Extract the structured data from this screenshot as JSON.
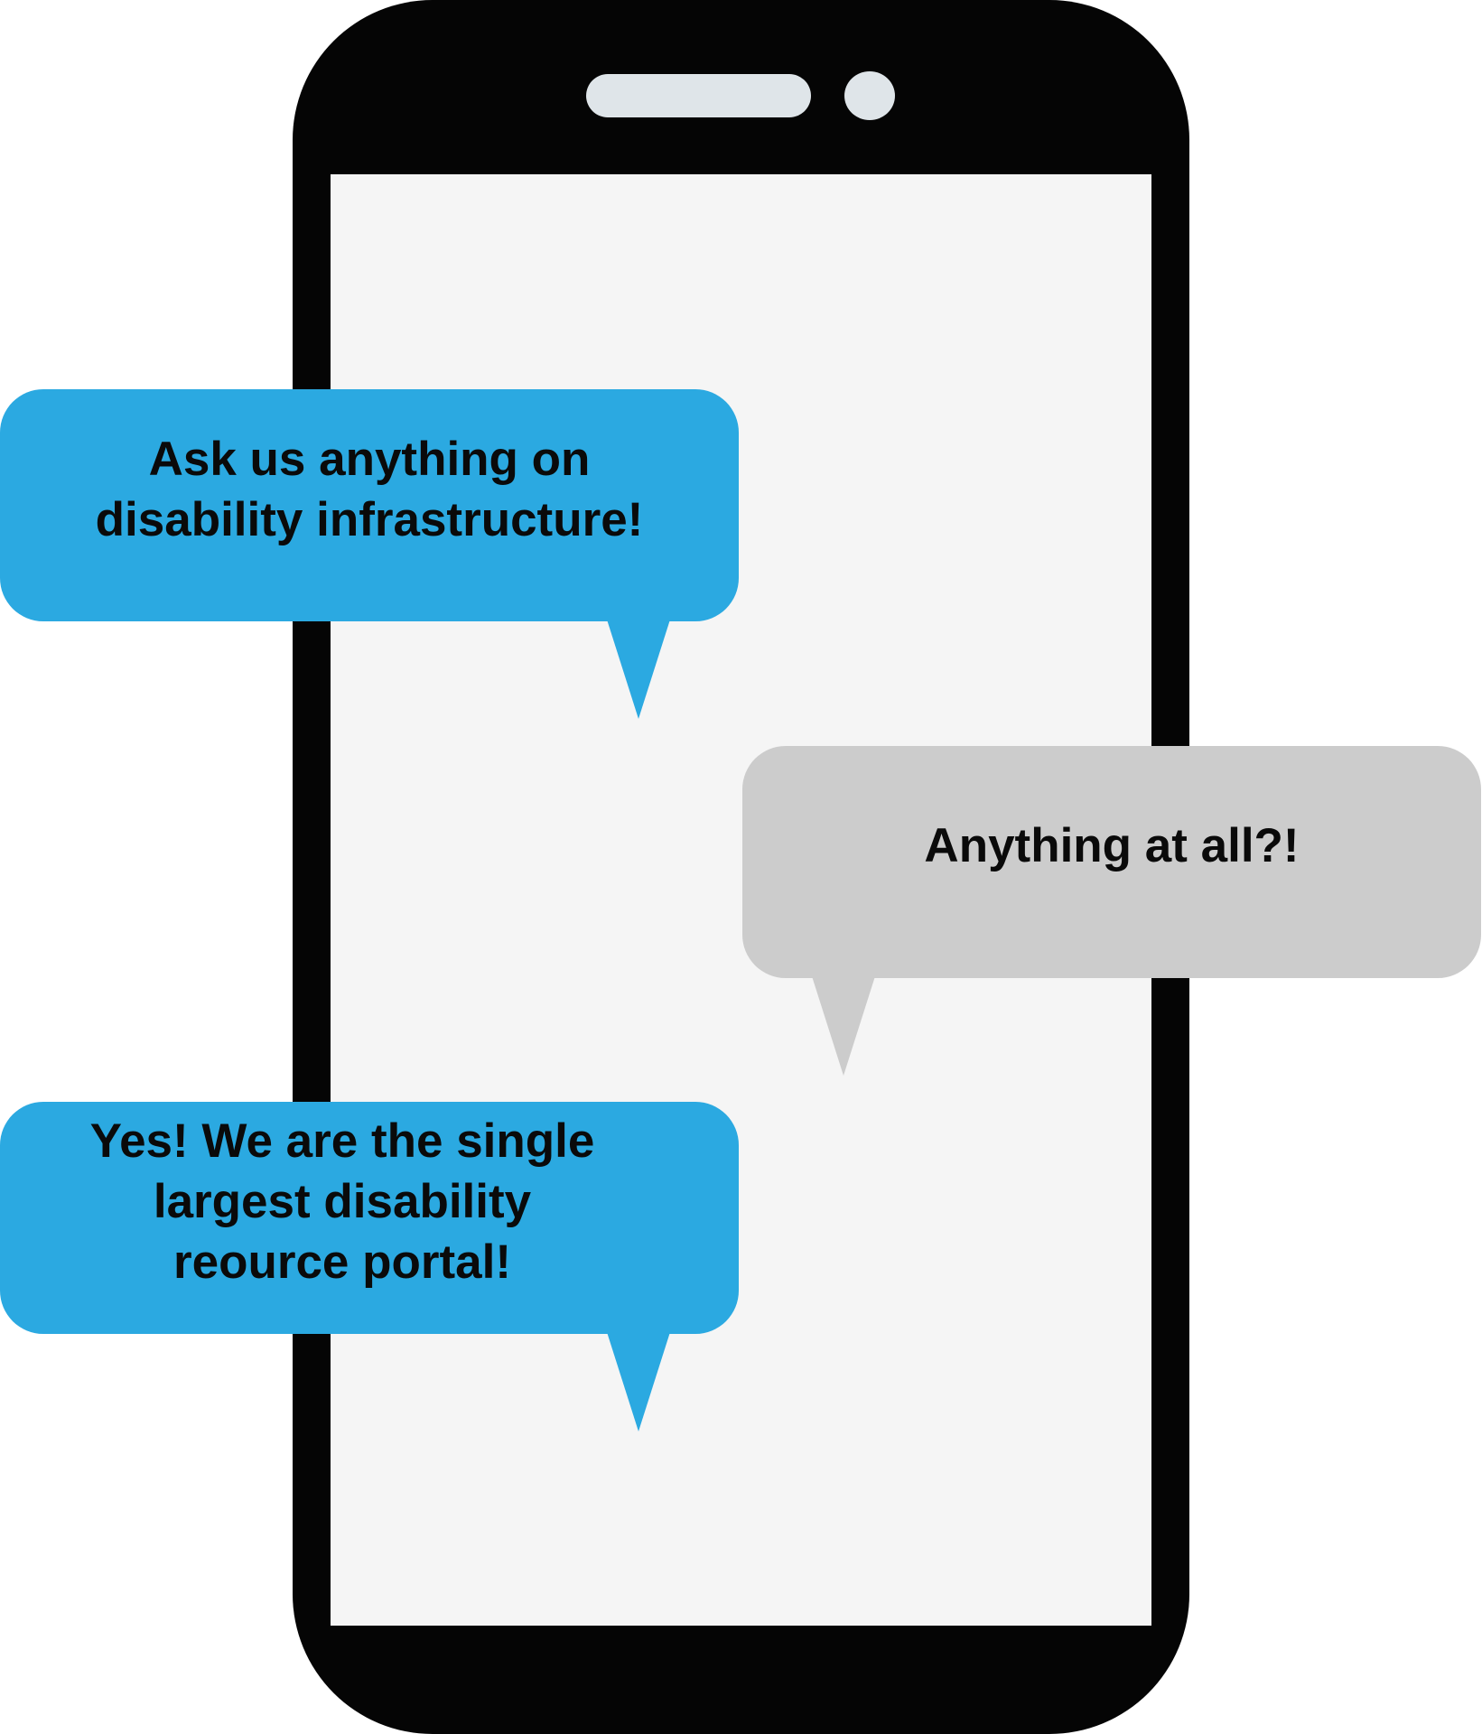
{
  "messages": [
    {
      "sender": "us",
      "text": "Ask us anything on disability infrastructure!",
      "lines": [
        "Ask us anything on",
        "disability infrastructure!"
      ]
    },
    {
      "sender": "user",
      "text": "Anything at all?!",
      "lines": [
        "Anything at all?!"
      ]
    },
    {
      "sender": "us",
      "text": "Yes! We are the single largest disability reource portal!",
      "lines": [
        "Yes! We are the single",
        "largest disability",
        "reource portal!"
      ]
    }
  ],
  "colors": {
    "phone_body": "#050505",
    "screen": "#f5f5f5",
    "speaker": "#dfe5e9",
    "bubble_us": "#2ba9e1",
    "bubble_user": "#cccccc",
    "text": "#0a0a0a"
  },
  "icons": [
    "phone-device",
    "speaker-slot",
    "front-camera"
  ]
}
